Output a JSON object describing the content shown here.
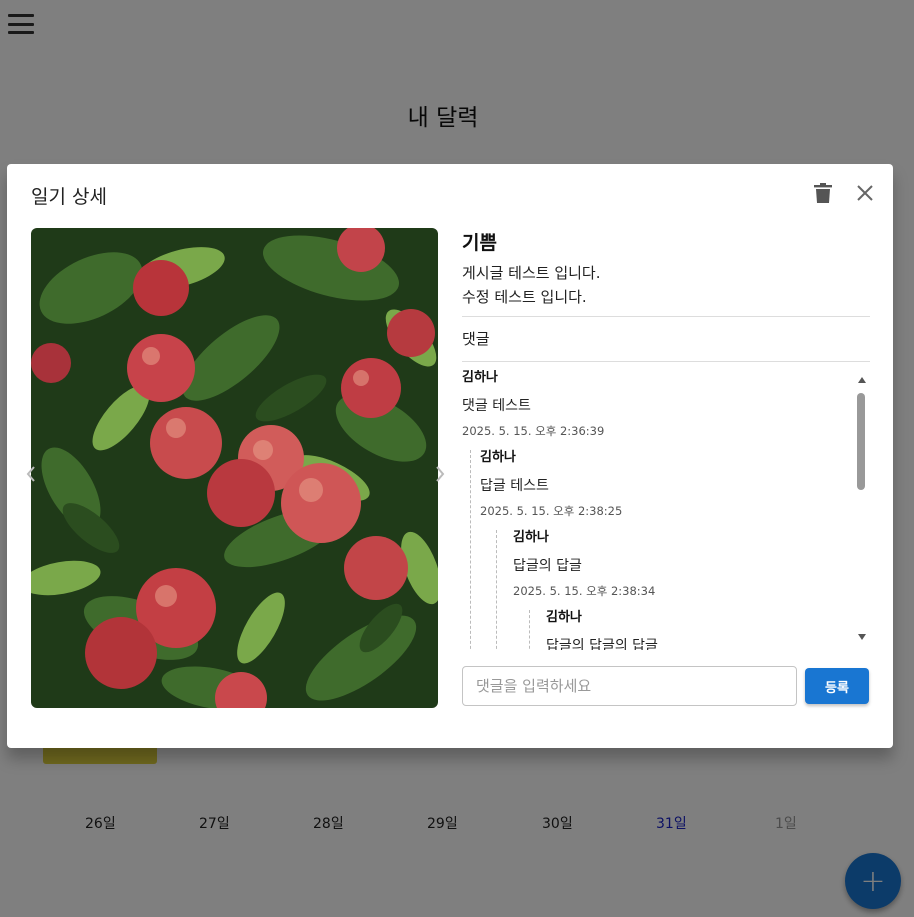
{
  "background": {
    "calendar_title": "내 달력",
    "days": [
      {
        "label": "26일",
        "type": "normal"
      },
      {
        "label": "27일",
        "type": "normal"
      },
      {
        "label": "28일",
        "type": "normal"
      },
      {
        "label": "29일",
        "type": "normal"
      },
      {
        "label": "30일",
        "type": "normal"
      },
      {
        "label": "31일",
        "type": "sun"
      },
      {
        "label": "1일",
        "type": "other"
      }
    ],
    "fab_label": "+"
  },
  "modal": {
    "title": "일기 상세",
    "mood": "기쁨",
    "content_lines": [
      "게시글 테스트 입니다.",
      "수정 테스트 입니다."
    ],
    "comments_label": "댓글",
    "comments": [
      {
        "author": "김하나",
        "text": "댓글 테스트",
        "date": "2025. 5. 15. 오후 2:36:39"
      },
      {
        "author": "김하나",
        "text": "답글 테스트",
        "date": "2025. 5. 15. 오후 2:38:25"
      },
      {
        "author": "김하나",
        "text": "답글의 답글",
        "date": "2025. 5. 15. 오후 2:38:34"
      },
      {
        "author": "김하나",
        "text": "답글의 답글의 답글",
        "date": ""
      }
    ],
    "input_placeholder": "댓글을 입력하세요",
    "submit_label": "등록"
  },
  "colors": {
    "primary": "#1976d2",
    "sunday": "#1a23c9",
    "event_chip": "#e0d23f",
    "overlay": "rgba(0,0,0,0.5)"
  },
  "icons": [
    "menu-icon",
    "delete-icon",
    "close-icon",
    "chevron-left-icon",
    "chevron-right-icon",
    "plus-icon"
  ]
}
